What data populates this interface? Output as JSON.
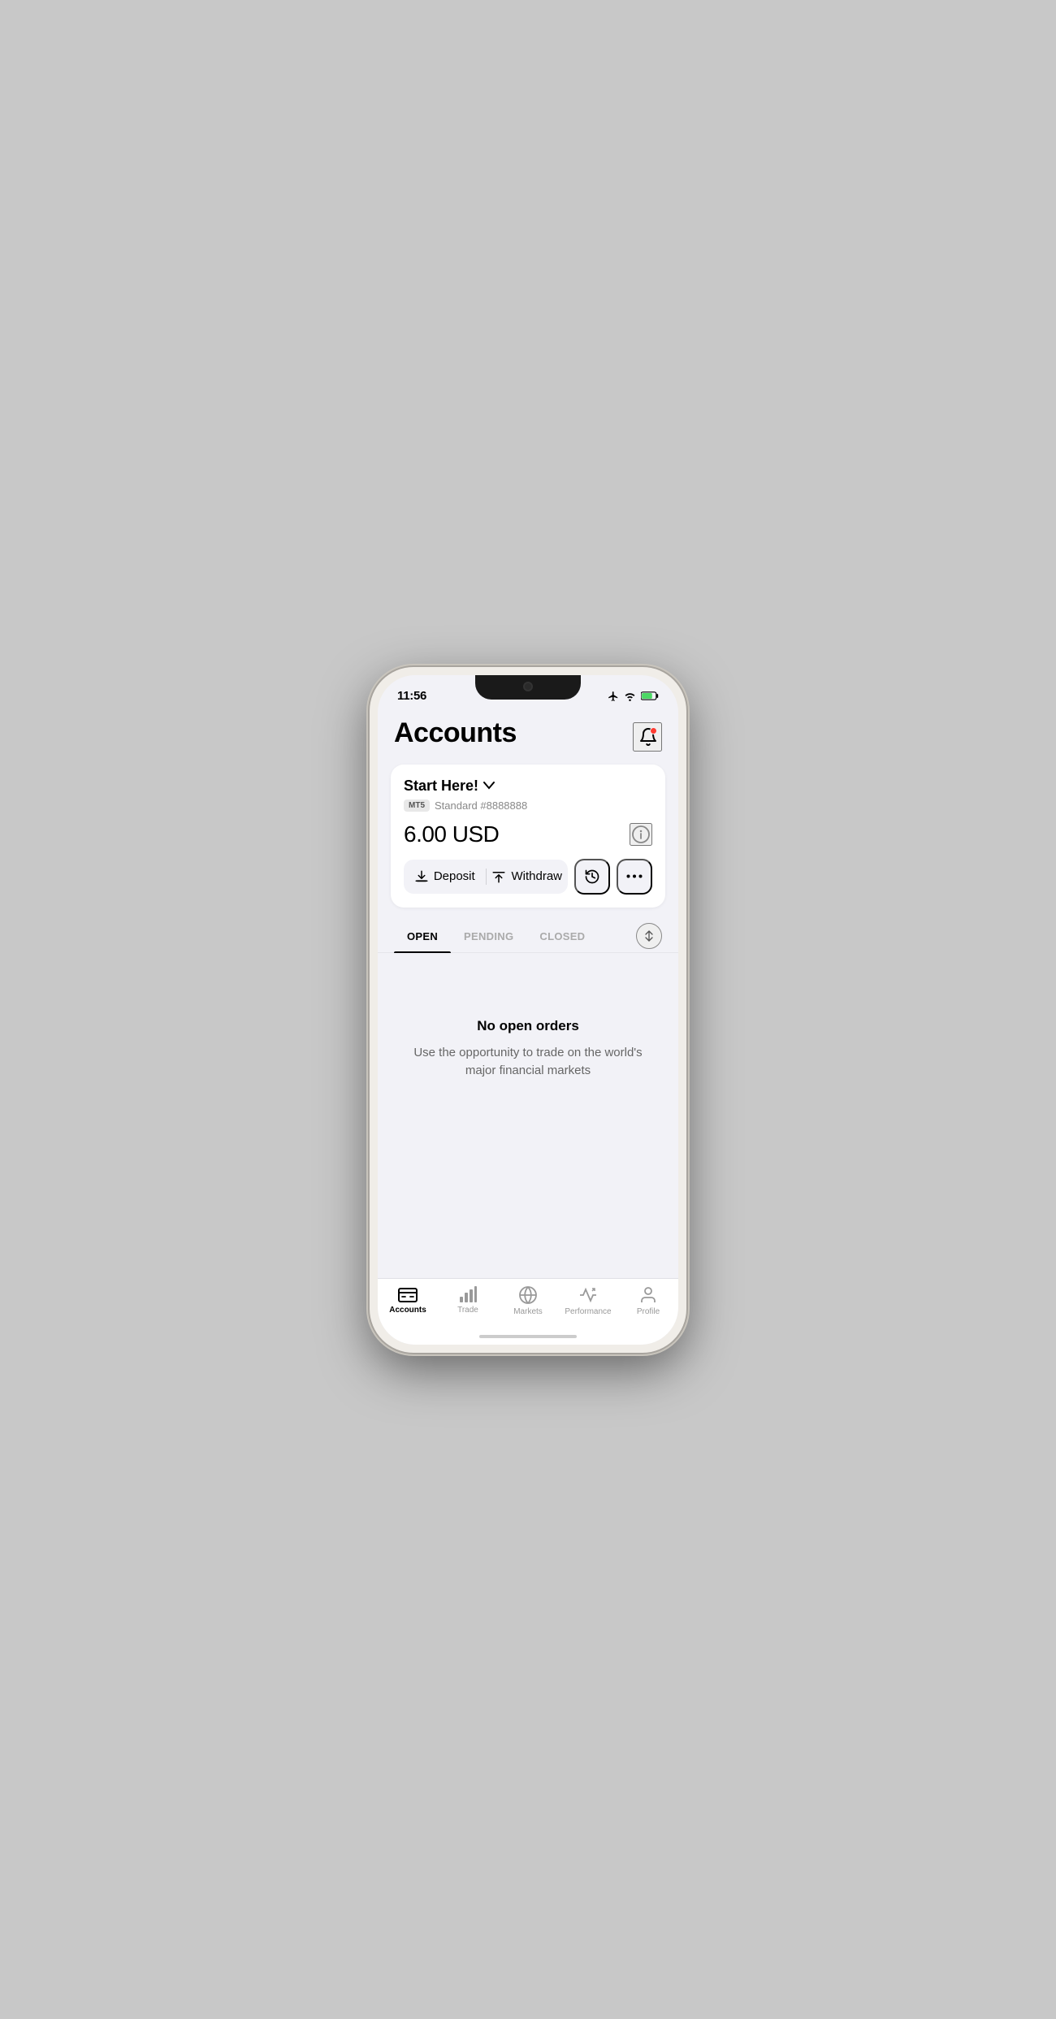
{
  "statusBar": {
    "time": "11:56",
    "icons": [
      "airplane",
      "wifi",
      "battery"
    ]
  },
  "header": {
    "title": "Accounts",
    "notificationLabel": "Notifications"
  },
  "accountCard": {
    "name": "Start Here!",
    "badge": "MT5",
    "accountType": "Standard",
    "accountNumber": "#8888888",
    "balance": "6.00 USD",
    "infoLabel": "Account info",
    "depositLabel": "Deposit",
    "withdrawLabel": "Withdraw",
    "historyLabel": "History",
    "moreLabel": "More"
  },
  "tabs": [
    {
      "id": "open",
      "label": "OPEN",
      "active": true
    },
    {
      "id": "pending",
      "label": "PENDING",
      "active": false
    },
    {
      "id": "closed",
      "label": "CLOSED",
      "active": false
    }
  ],
  "sortLabel": "Sort",
  "emptyState": {
    "title": "No open orders",
    "description": "Use the opportunity to trade on the world's major financial markets"
  },
  "bottomNav": [
    {
      "id": "accounts",
      "label": "Accounts",
      "active": true
    },
    {
      "id": "trade",
      "label": "Trade",
      "active": false
    },
    {
      "id": "markets",
      "label": "Markets",
      "active": false
    },
    {
      "id": "performance",
      "label": "Performance",
      "active": false
    },
    {
      "id": "profile",
      "label": "Profile",
      "active": false
    }
  ]
}
